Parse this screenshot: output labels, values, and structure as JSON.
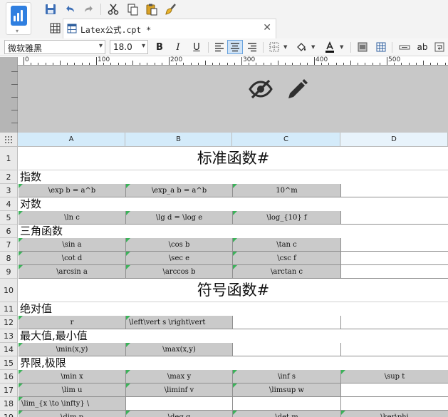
{
  "app": {
    "logo_icon": "app-logo-icon"
  },
  "quick_toolbar": {
    "items": [
      {
        "name": "save-button",
        "icon": "save-icon"
      },
      {
        "name": "undo-button",
        "icon": "undo-icon"
      },
      {
        "name": "redo-button",
        "icon": "redo-icon"
      },
      {
        "name": "cut-button",
        "icon": "scissors-icon"
      },
      {
        "name": "copy-button",
        "icon": "copy-icon"
      },
      {
        "name": "paste-button",
        "icon": "paste-icon"
      },
      {
        "name": "format-painter-button",
        "icon": "brush-icon"
      }
    ]
  },
  "tabs": [
    {
      "label": "Latex公式.cpt *",
      "active": true
    }
  ],
  "format_bar": {
    "font_family": "微软雅黑",
    "font_size": "18.0",
    "bold_label": "B",
    "italic_label": "I",
    "underline_label": "U",
    "text_direction_label": "ab"
  },
  "ruler": {
    "labels": [
      "0",
      "100",
      "200",
      "300",
      "400",
      "500"
    ]
  },
  "colors": {
    "accent": "#2f7fe0",
    "selected_header": "#d4ebfa",
    "flag": "#3cb25a",
    "cell_gray": "#cacaca"
  },
  "sheet": {
    "columns": [
      "A",
      "B",
      "C",
      "D"
    ],
    "rows": [
      {
        "num": "1",
        "type": "title",
        "text": "标准函数#"
      },
      {
        "num": "2",
        "type": "section",
        "text": "指数"
      },
      {
        "num": "3",
        "type": "cells",
        "cells": [
          {
            "text": "\\exp b = a^b",
            "style": "gray"
          },
          {
            "text": "\\exp_a b = a^b",
            "style": "gray"
          },
          {
            "text": "10^m",
            "style": "gray"
          },
          {
            "text": "",
            "style": "white"
          }
        ]
      },
      {
        "num": "4",
        "type": "section",
        "text": "对数"
      },
      {
        "num": "5",
        "type": "cells",
        "cells": [
          {
            "text": "\\ln c",
            "style": "gray"
          },
          {
            "text": "\\lg d = \\log e",
            "style": "gray"
          },
          {
            "text": "\\log_{10} f",
            "style": "gray"
          },
          {
            "text": "",
            "style": "white"
          }
        ]
      },
      {
        "num": "6",
        "type": "section",
        "text": "三角函数"
      },
      {
        "num": "7",
        "type": "cells",
        "cells": [
          {
            "text": "\\sin a",
            "style": "gray"
          },
          {
            "text": "\\cos b",
            "style": "gray"
          },
          {
            "text": "\\tan c",
            "style": "gray"
          },
          {
            "text": "",
            "style": "white"
          }
        ]
      },
      {
        "num": "8",
        "type": "cells",
        "cells": [
          {
            "text": "\\cot d",
            "style": "gray"
          },
          {
            "text": "\\sec e",
            "style": "gray"
          },
          {
            "text": "\\csc f",
            "style": "gray"
          },
          {
            "text": "",
            "style": "white"
          }
        ]
      },
      {
        "num": "9",
        "type": "cells",
        "cells": [
          {
            "text": "\\arcsin a",
            "style": "gray"
          },
          {
            "text": "\\arccos b",
            "style": "gray"
          },
          {
            "text": "\\arctan c",
            "style": "gray"
          },
          {
            "text": "",
            "style": "white"
          }
        ]
      },
      {
        "num": "10",
        "type": "title",
        "text": "符号函数#"
      },
      {
        "num": "11",
        "type": "section",
        "text": "绝对值"
      },
      {
        "num": "12",
        "type": "cells",
        "cells": [
          {
            "text": "r",
            "style": "gray"
          },
          {
            "text": "\\left\\vert s \\right\\vert",
            "style": "gray"
          },
          {
            "text": "",
            "style": "white"
          },
          {
            "text": "",
            "style": "white"
          }
        ]
      },
      {
        "num": "13",
        "type": "section",
        "text": "最大值,最小值"
      },
      {
        "num": "14",
        "type": "cells",
        "cells": [
          {
            "text": "\\min(x,y)",
            "style": "gray"
          },
          {
            "text": "\\max(x,y)",
            "style": "gray"
          },
          {
            "text": "",
            "style": "white"
          },
          {
            "text": "",
            "style": "white"
          }
        ]
      },
      {
        "num": "15",
        "type": "section",
        "text": "界限,极限"
      },
      {
        "num": "16",
        "type": "cells",
        "cells": [
          {
            "text": "\\min x",
            "style": "gray"
          },
          {
            "text": "\\max y",
            "style": "gray"
          },
          {
            "text": "\\inf s",
            "style": "gray"
          },
          {
            "text": "\\sup t",
            "style": "gray"
          }
        ]
      },
      {
        "num": "17",
        "type": "cells",
        "cells": [
          {
            "text": "\\lim u",
            "style": "gray"
          },
          {
            "text": "\\liminf v",
            "style": "gray"
          },
          {
            "text": "\\limsup w",
            "style": "gray"
          },
          {
            "text": "",
            "style": "white"
          }
        ]
      },
      {
        "num": "18",
        "type": "cells",
        "cells": [
          {
            "text": "\\lim_{x \\to \\infty} \\",
            "style": "gray"
          },
          {
            "text": "",
            "style": "white"
          },
          {
            "text": "",
            "style": "white"
          },
          {
            "text": "",
            "style": "white"
          }
        ]
      },
      {
        "num": "19",
        "type": "cells",
        "cells": [
          {
            "text": "\\dim p",
            "style": "gray"
          },
          {
            "text": "\\deg q",
            "style": "gray"
          },
          {
            "text": "\\det m",
            "style": "gray"
          },
          {
            "text": "\\ker\\phi",
            "style": "gray"
          }
        ]
      }
    ]
  }
}
